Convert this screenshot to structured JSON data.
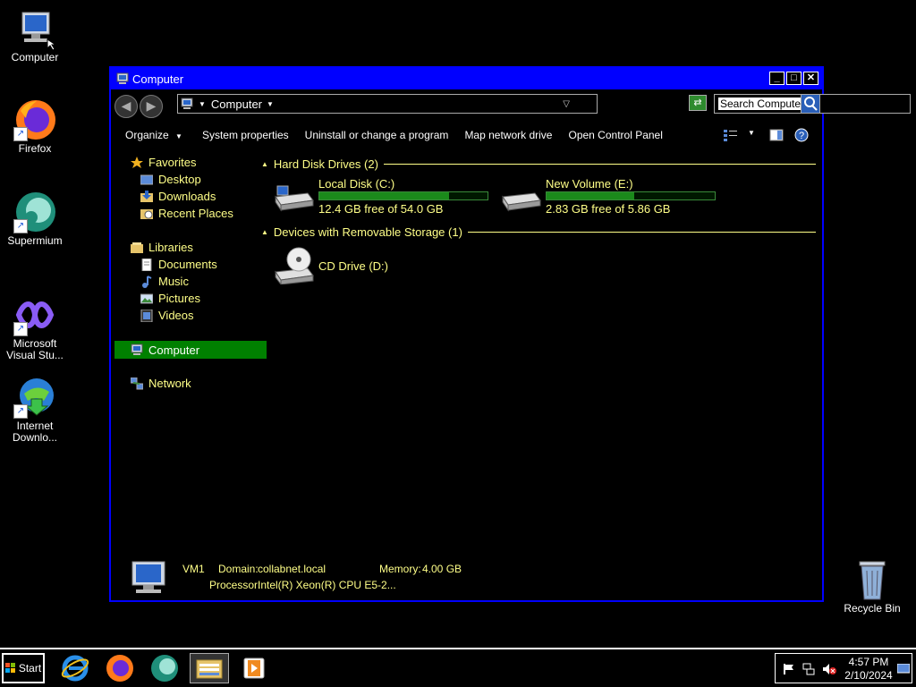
{
  "desktop": {
    "icons": [
      {
        "label": "Computer",
        "icon": "computer-icon"
      },
      {
        "label": "Firefox",
        "icon": "firefox-icon"
      },
      {
        "label": "Supermium",
        "icon": "supermium-icon"
      },
      {
        "label": "Microsoft Visual Stu...",
        "icon": "visual-studio-icon"
      },
      {
        "label": "Internet Downlo...",
        "icon": "internet-download-manager-icon"
      },
      {
        "label": "Recycle Bin",
        "icon": "recycle-bin-icon"
      }
    ]
  },
  "window": {
    "title": "Computer",
    "address": {
      "location": "Computer"
    },
    "search": {
      "placeholder": "Search Computer"
    },
    "toolbar": {
      "organize": "Organize",
      "system_properties": "System properties",
      "uninstall": "Uninstall or change a program",
      "map_drive": "Map network drive",
      "control_panel": "Open Control Panel"
    },
    "nav": {
      "favorites": "Favorites",
      "desktop": "Desktop",
      "downloads": "Downloads",
      "recent_places": "Recent Places",
      "libraries": "Libraries",
      "documents": "Documents",
      "music": "Music",
      "pictures": "Pictures",
      "videos": "Videos",
      "computer": "Computer",
      "network": "Network"
    },
    "groups": {
      "hard_disks": "Hard Disk Drives (2)",
      "removable": "Devices with Removable Storage (1)"
    },
    "drives": [
      {
        "name": "Local Disk (C:)",
        "free": "12.4 GB free of 54.0 GB",
        "used_fraction": 0.77
      },
      {
        "name": "New Volume (E:)",
        "free": "2.83 GB free of 5.86 GB",
        "used_fraction": 0.52
      }
    ],
    "cd_drive": {
      "name": "CD Drive (D:)"
    },
    "details": {
      "name": "VM1",
      "domain_label": "Domain:",
      "domain": "collabnet.local",
      "memory_label": "Memory:",
      "memory": "4.00 GB",
      "processor_label": "Processor:",
      "processor": "Intel(R) Xeon(R) CPU E5-2..."
    }
  },
  "taskbar": {
    "start": "Start",
    "apps": [
      "internet-explorer-icon",
      "firefox-icon",
      "supermium-icon",
      "file-explorer-icon",
      "media-player-icon"
    ],
    "clock": {
      "time": "4:57 PM",
      "date": "2/10/2024"
    }
  },
  "colors": {
    "titlebar": "#0000ff",
    "text_highlight": "#ffff88",
    "selection": "#008000",
    "bar_fill": "#1b8a1b"
  }
}
